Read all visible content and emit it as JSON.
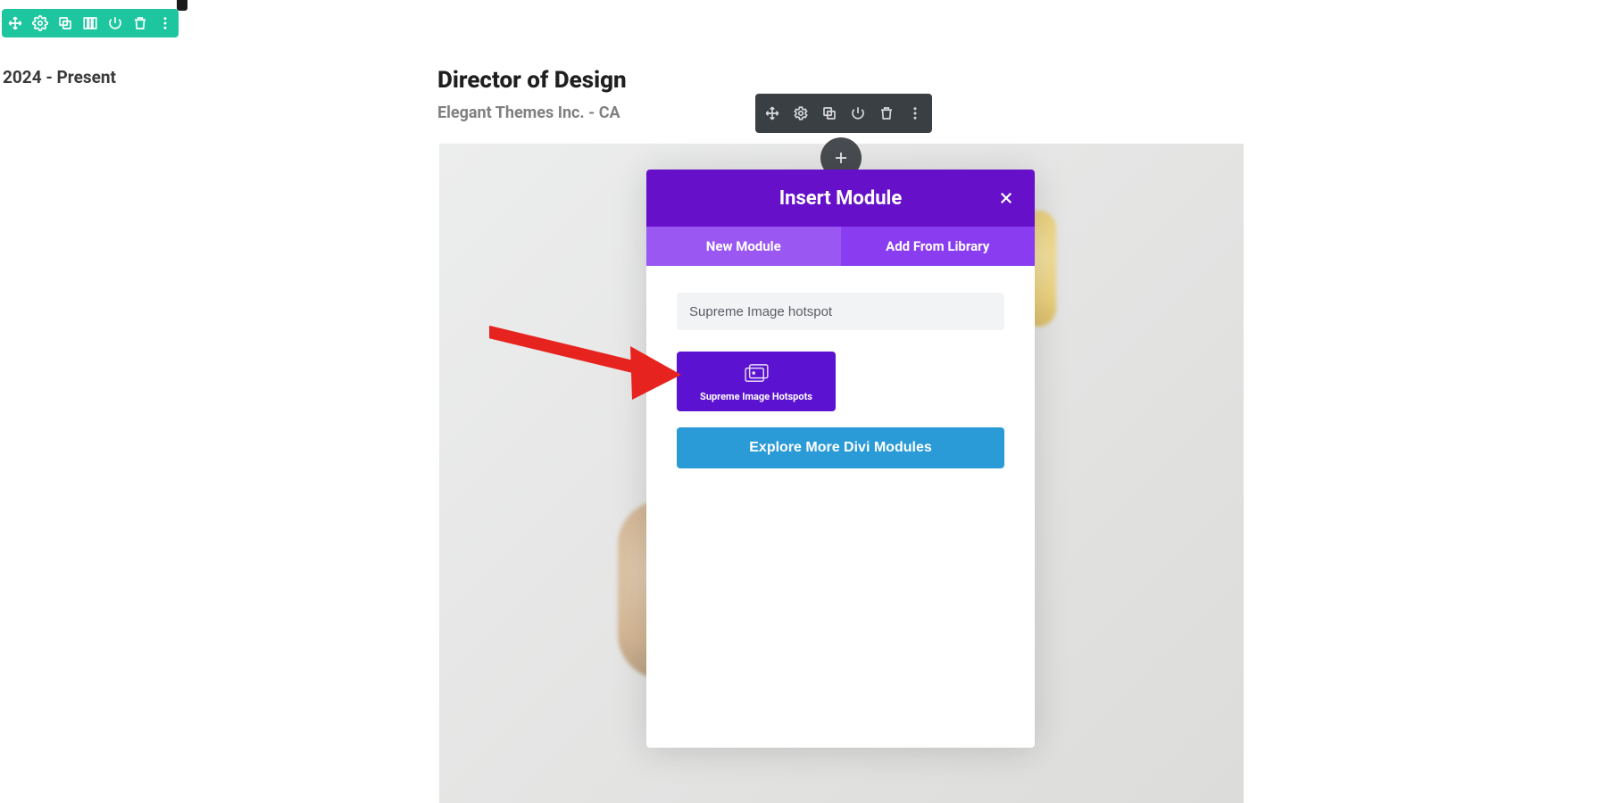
{
  "date_text": "2024 - Present",
  "job_title": "Director of Design",
  "job_subtitle": "Elegant Themes Inc. - CA",
  "modal": {
    "title": "Insert Module",
    "tab_new": "New Module",
    "tab_library": "Add From Library",
    "search_value": "Supreme Image hotspot",
    "module_card_label": "Supreme Image Hotspots",
    "explore_label": "Explore More Divi Modules"
  },
  "colors": {
    "teal": "#1ec6a0",
    "dark": "#3a3f44",
    "purple_header": "#6610c9",
    "purple_tab": "#8a3df0",
    "purple_tab_active": "#9b57f2",
    "purple_card": "#5b12d1",
    "blue": "#2b9bd8",
    "red": "#e6231f"
  }
}
